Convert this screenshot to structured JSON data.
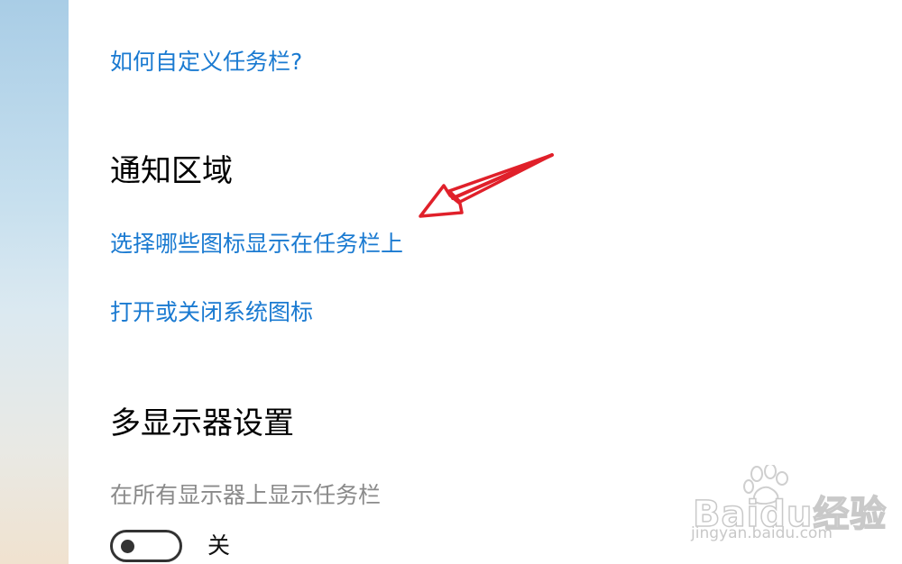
{
  "links": {
    "customize_taskbar": "如何自定义任务栏?",
    "select_tray_icons": "选择哪些图标显示在任务栏上",
    "system_icons": "打开或关闭系统图标"
  },
  "sections": {
    "notification_area": "通知区域",
    "multiple_displays": "多显示器设置"
  },
  "multi_display": {
    "show_taskbar_label": "在所有显示器上显示任务栏",
    "toggle_state": "关",
    "toggle_on": false
  },
  "watermark": {
    "brand": "Bai",
    "brand_suffix": "du",
    "brand_cn": "经验",
    "site": "jingyan.baidu.com"
  },
  "colors": {
    "link": "#1a7ad1",
    "disabled_text": "#8a8a8a",
    "annotation_arrow": "#e0202a"
  },
  "icons": {
    "annotation": "red-arrow-icon",
    "watermark": "baidu-paw-icon"
  }
}
